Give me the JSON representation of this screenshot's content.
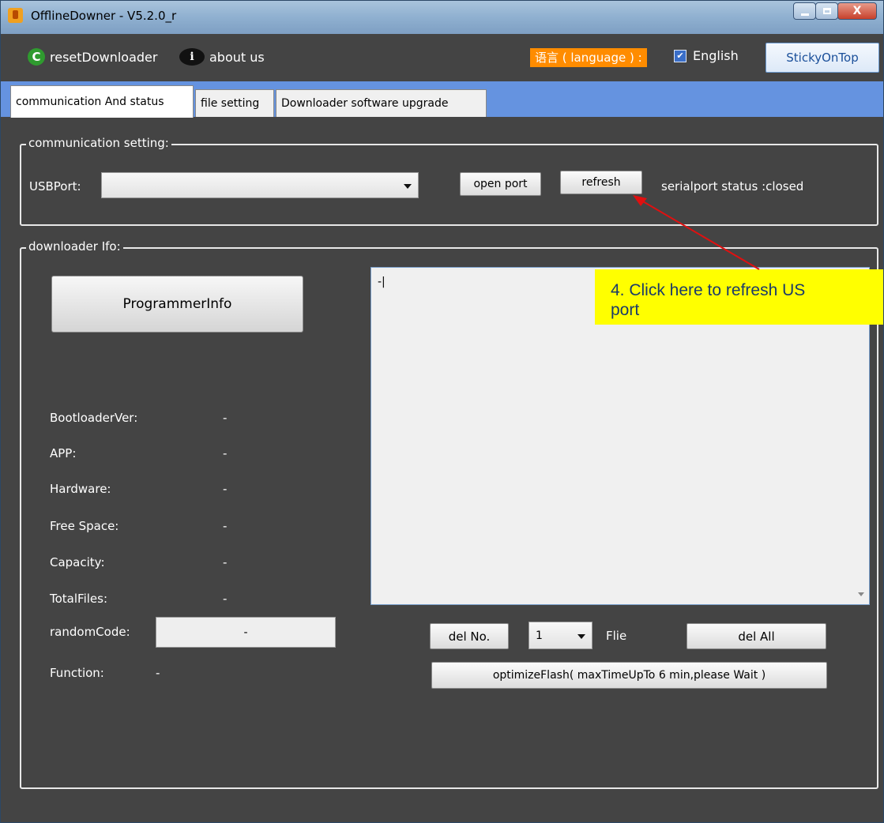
{
  "window": {
    "title": "OfflineDowner - V5.2.0_r",
    "close_glyph": "X"
  },
  "toolbar": {
    "reset_label": "resetDownloader",
    "about_label": "about us",
    "language_label": "语言 ( language ) :",
    "english_label": "English",
    "english_checked": true,
    "sticky_label": "StickyOnTop"
  },
  "tabs": [
    {
      "label": "communication And status",
      "active": true
    },
    {
      "label": "file setting",
      "active": false
    },
    {
      "label": "Downloader software upgrade",
      "active": false
    }
  ],
  "communication": {
    "group_title": "communication setting:",
    "usb_label": "USBPort:",
    "usb_value": "",
    "open_port_label": "open port",
    "refresh_label": "refresh",
    "status_text": "serialport status :closed"
  },
  "downloader": {
    "group_title": "downloader Ifo:",
    "programmer_info_label": "ProgrammerInfo",
    "fields": [
      {
        "label": "BootloaderVer:",
        "value": "-"
      },
      {
        "label": "APP:",
        "value": "-"
      },
      {
        "label": "Hardware:",
        "value": "-"
      },
      {
        "label": "Free Space:",
        "value": "-"
      },
      {
        "label": "Capacity:",
        "value": "-"
      },
      {
        "label": "TotalFiles:",
        "value": "-"
      }
    ],
    "random_code_label": "randomCode:",
    "random_code_value": "-",
    "function_label": "Function:",
    "function_value": "-",
    "log_text": "-|",
    "del_no_label": "del No.",
    "file_number": "1",
    "file_label": "Flie",
    "del_all_label": "del All",
    "optimize_label": "optimizeFlash( maxTimeUpTo 6 min,please Wait )"
  },
  "annotation": {
    "text": "4. Click here  to refresh US\nport",
    "color": "#ffff00",
    "arrow_color": "#e01010"
  }
}
